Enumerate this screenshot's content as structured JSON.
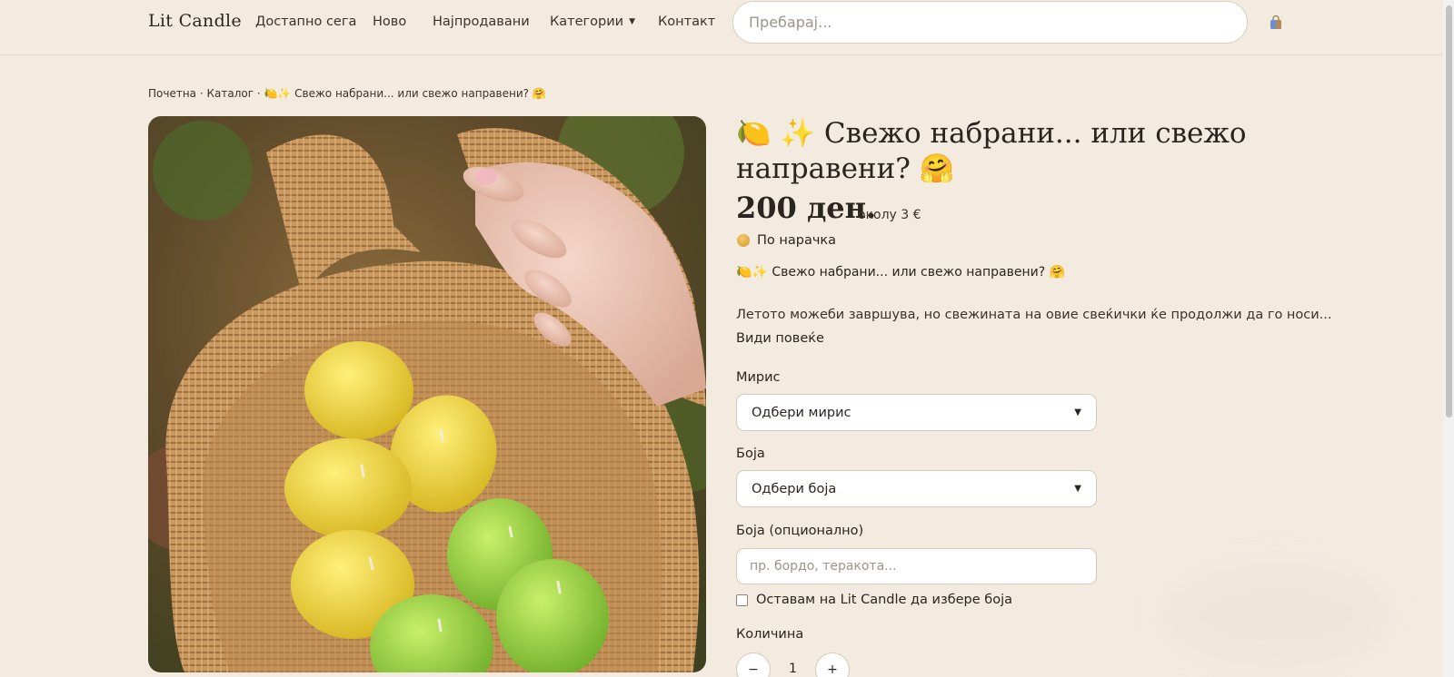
{
  "header": {
    "brand": "Lit Candle",
    "nav": [
      "Достапно сега",
      "Ново",
      "Најпродавани",
      "Категории",
      "Контакт"
    ],
    "categories_caret": "▼",
    "search_placeholder": "Пребарај...",
    "cart_icon": "shopping-bag-icon"
  },
  "breadcrumb": "Почетна · Каталог · 🍋✨ Свежо набрани... или свежо направени? 🤗",
  "product": {
    "title": "🍋 ✨ Свежо набрани... или свежо направени? 🤗",
    "price": "200 ден.",
    "price_approx": "околу 3 €",
    "availability": "По нарачка",
    "subline": "🍋✨ Свежо набрани... или свежо направени? 🤗",
    "description": "Летото можеби завршува, но свежината на овие свеќички ќе продолжи да го носи...",
    "see_more": "Види повеќе"
  },
  "form": {
    "scent_label": "Мирис",
    "scent_value": "Одбери мирис",
    "color_label": "Боја",
    "color_value": "Одбери боја",
    "color_optional_label": "Боја (опционално)",
    "color_optional_placeholder": "пр. бордо, теракота...",
    "checkbox_label": "Оставам на Lit Candle да избере боја",
    "checkbox_checked": false,
    "quantity_label": "Количина",
    "quantity": "1",
    "minus": "−",
    "plus": "+"
  },
  "colors": {
    "background": "#f3ebdf",
    "text": "#2b2520",
    "field_border": "#d4cabb"
  }
}
